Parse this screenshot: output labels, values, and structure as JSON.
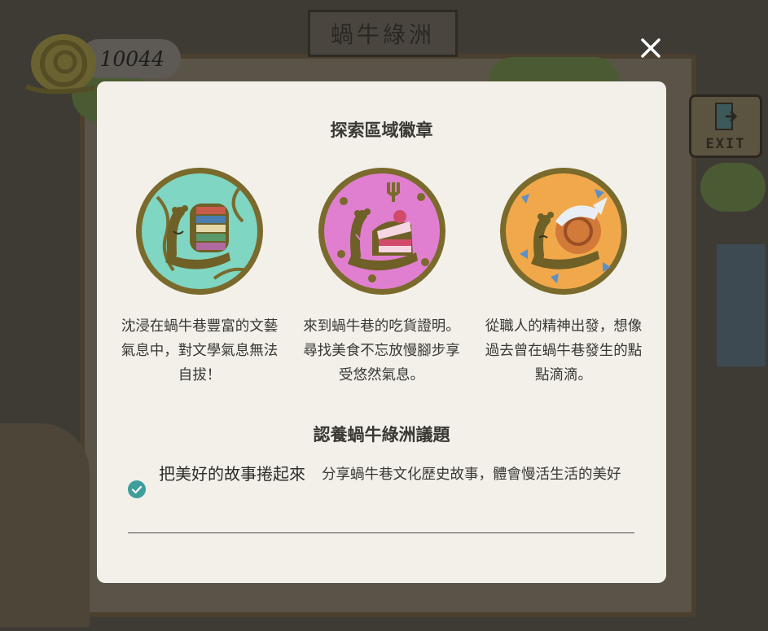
{
  "header": {
    "title_sign": "蝸牛綠洲",
    "score": "10044",
    "exit_label": "EXIT"
  },
  "modal": {
    "title": "探索區域徽章",
    "badges": [
      {
        "icon": "book-snail-badge-icon",
        "description": "沈浸在蝸牛巷豐富的文藝氣息中，對文學氣息無法自拔！"
      },
      {
        "icon": "cake-snail-badge-icon",
        "description": "來到蝸牛巷的吃貨證明。尋找美食不忘放慢腳步享受悠然氣息。"
      },
      {
        "icon": "artisan-snail-badge-icon",
        "description": "從職人的精神出發，想像過去曾在蝸牛巷發生的點點滴滴。"
      }
    ],
    "section_title": "認養蝸牛綠洲議題",
    "topics": [
      {
        "name": "把美好的故事捲起來",
        "description": "分享蝸牛巷文化歷史故事，體會慢活生活的美好",
        "checked": true
      }
    ]
  },
  "colors": {
    "modal_bg": "#f2f0e9",
    "check_teal": "#3d9e9c",
    "badge_teal": "#7fd6c2",
    "badge_pink": "#e07fcf",
    "badge_orange": "#f0a84a",
    "badge_rim": "#7a6a2c"
  }
}
